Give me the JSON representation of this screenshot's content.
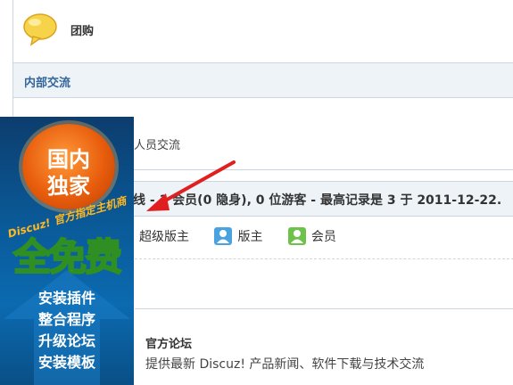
{
  "forum": {
    "name": "团购",
    "icon": "speech-bubble-icon"
  },
  "section": {
    "title": "内部交流"
  },
  "subforum": {
    "desc_partial": "人员交流"
  },
  "online": {
    "text": "线 - 1 会员(0 隐身), 0 位游客 - 最高记录是 3 于 2011-12-22."
  },
  "legend": [
    {
      "label": "超级版主",
      "icon": "super-moderator-icon",
      "color": "#f0a030"
    },
    {
      "label": "版主",
      "icon": "moderator-icon",
      "color": "#4aa3df"
    },
    {
      "label": "会员",
      "icon": "member-icon",
      "color": "#6cc24a"
    }
  ],
  "official": {
    "title": "官方论坛",
    "desc": "提供最新 Discuz! 产品新闻、软件下载与技术交流"
  },
  "ad": {
    "badge_line1": "国内",
    "badge_line2": "独家",
    "tagline": "Discuz! 官方指定主机商",
    "headline": "全免费",
    "items": [
      "安装插件",
      "整合程序",
      "升级论坛",
      "安装模板"
    ]
  },
  "colors": {
    "section_bg": "#eef3f7",
    "section_title": "#336699",
    "arrow": "#e02020"
  }
}
